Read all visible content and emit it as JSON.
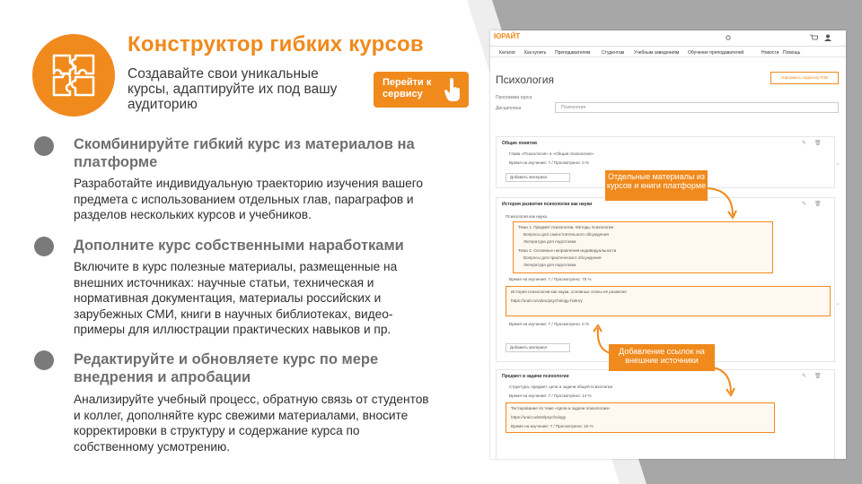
{
  "header": {
    "title": "Конструктор гибких курсов",
    "subtitle": "Создавайте свои уникальные курсы, адаптируйте их под вашу аудиторию",
    "cta_label": "Перейти к сервису"
  },
  "sections": [
    {
      "title": "Скомбинируйте гибкий курс из материалов на платформе",
      "body": "Разработайте индивидуальную траекторию изучения вашего предмета с использованием отдельных глав, параграфов и разделов нескольких курсов и учебников."
    },
    {
      "title": "Дополните курс собственными наработками",
      "body": "Включите в курс полезные материалы, размещенные на внешних источниках: научные статьи, техническая и нормативная документация, материалы российских и зарубежных СМИ, книги в научных библиотеках, видео-примеры для иллюстрации практических навыков и пр."
    },
    {
      "title": "Редактируйте и обновляете курс по мере внедрения и апробации",
      "body": "Анализируйте учебный процесс, обратную связь от студентов и коллег, дополняйте курс свежими материалами, вносите корректировки в структуру и содержание курса по собственному усмотрению."
    }
  ],
  "screenshot": {
    "logo": "ЮРАЙТ",
    "menu": [
      "Каталог",
      "Как купить",
      "Преподавателям",
      "Студентам",
      "Учебным заведениям",
      "Обучение преподавателей",
      "Новости",
      "Помощь"
    ],
    "page_title": "Психология",
    "subscribe_label": "Оформить подписку РЗВ",
    "program_label": "Программа курса",
    "discipline_label": "Дисциплина",
    "discipline_value": "Психология",
    "card1_title": "Общие понятия",
    "card1_line": "Глава «Психология» в «Общая психология»",
    "card1_meta": "Время на изучение: 7 / Просмотрено: 0 %",
    "add_material": "Добавить материал",
    "card2_title": "История развития психологии как науки",
    "card2_sub": "Психология как наука",
    "card2_items": [
      "Тема 1. Предмет психологии. Методы психологии",
      "Вопросы для самостоятельного обсуждения",
      "Литература для подготовки",
      "Тема 2. Основные направления индивидуальности",
      "Вопросы для практического обсуждения",
      "Литература для подготовки"
    ],
    "card2_meta": "Время на изучение: 7 / Просмотрено: 75 %",
    "card2_link_title": "История психологии как науки, основные этапы её развития",
    "card2_url": "https://urait.ru/video/psychology-history",
    "card2_meta2": "Время на изучение: 7 / Просмотрено: 0 %",
    "card3_title": "Предмет и задачи психологии",
    "card3_items": [
      "Структура, предмет, цели и задачи общей психологии",
      "Время на изучение: 7 / Просмотрено: 14 %",
      "Тестирование по теме «Цели и задачи психологии»",
      "https://urait.ru/test/psychology",
      "Время на изучение: 7 / Просмотрено: 15 %"
    ],
    "callout1": "Отдельные материалы из курсов и книги платформе",
    "callout2": "Добавление ссылок на внешние источники"
  },
  "colors": {
    "accent": "#f08a1c",
    "grey_band": "#a7a7a7",
    "bullet": "#7a7a7a"
  }
}
